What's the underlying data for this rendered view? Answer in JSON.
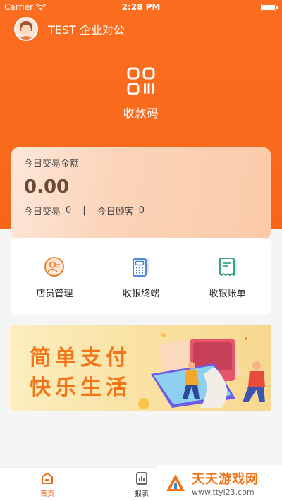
{
  "status_bar": {
    "carrier": "Carrier",
    "time": "2:28 PM"
  },
  "header": {
    "title": "TEST 企业对公"
  },
  "qr": {
    "label": "收款码",
    "icon": "qr-code-icon"
  },
  "stats": {
    "title": "今日交易金额",
    "amount": "0.00",
    "transactions_label": "今日交易",
    "transactions_value": "0",
    "separator": "|",
    "customers_label": "今日顾客",
    "customers_value": "0"
  },
  "features": [
    {
      "label": "店员管理",
      "icon": "staff-icon"
    },
    {
      "label": "收银终端",
      "icon": "terminal-icon"
    },
    {
      "label": "收银账单",
      "icon": "bill-icon"
    }
  ],
  "banner": {
    "line1": "简单支付",
    "line2": "快乐生活"
  },
  "nav": {
    "home_label": "首页",
    "report_label": "报表"
  },
  "watermark": {
    "title": "天天游戏网",
    "url": "www.ttyl23.com"
  },
  "colors": {
    "brand": "#f76518",
    "accent_text": "#f27519"
  }
}
